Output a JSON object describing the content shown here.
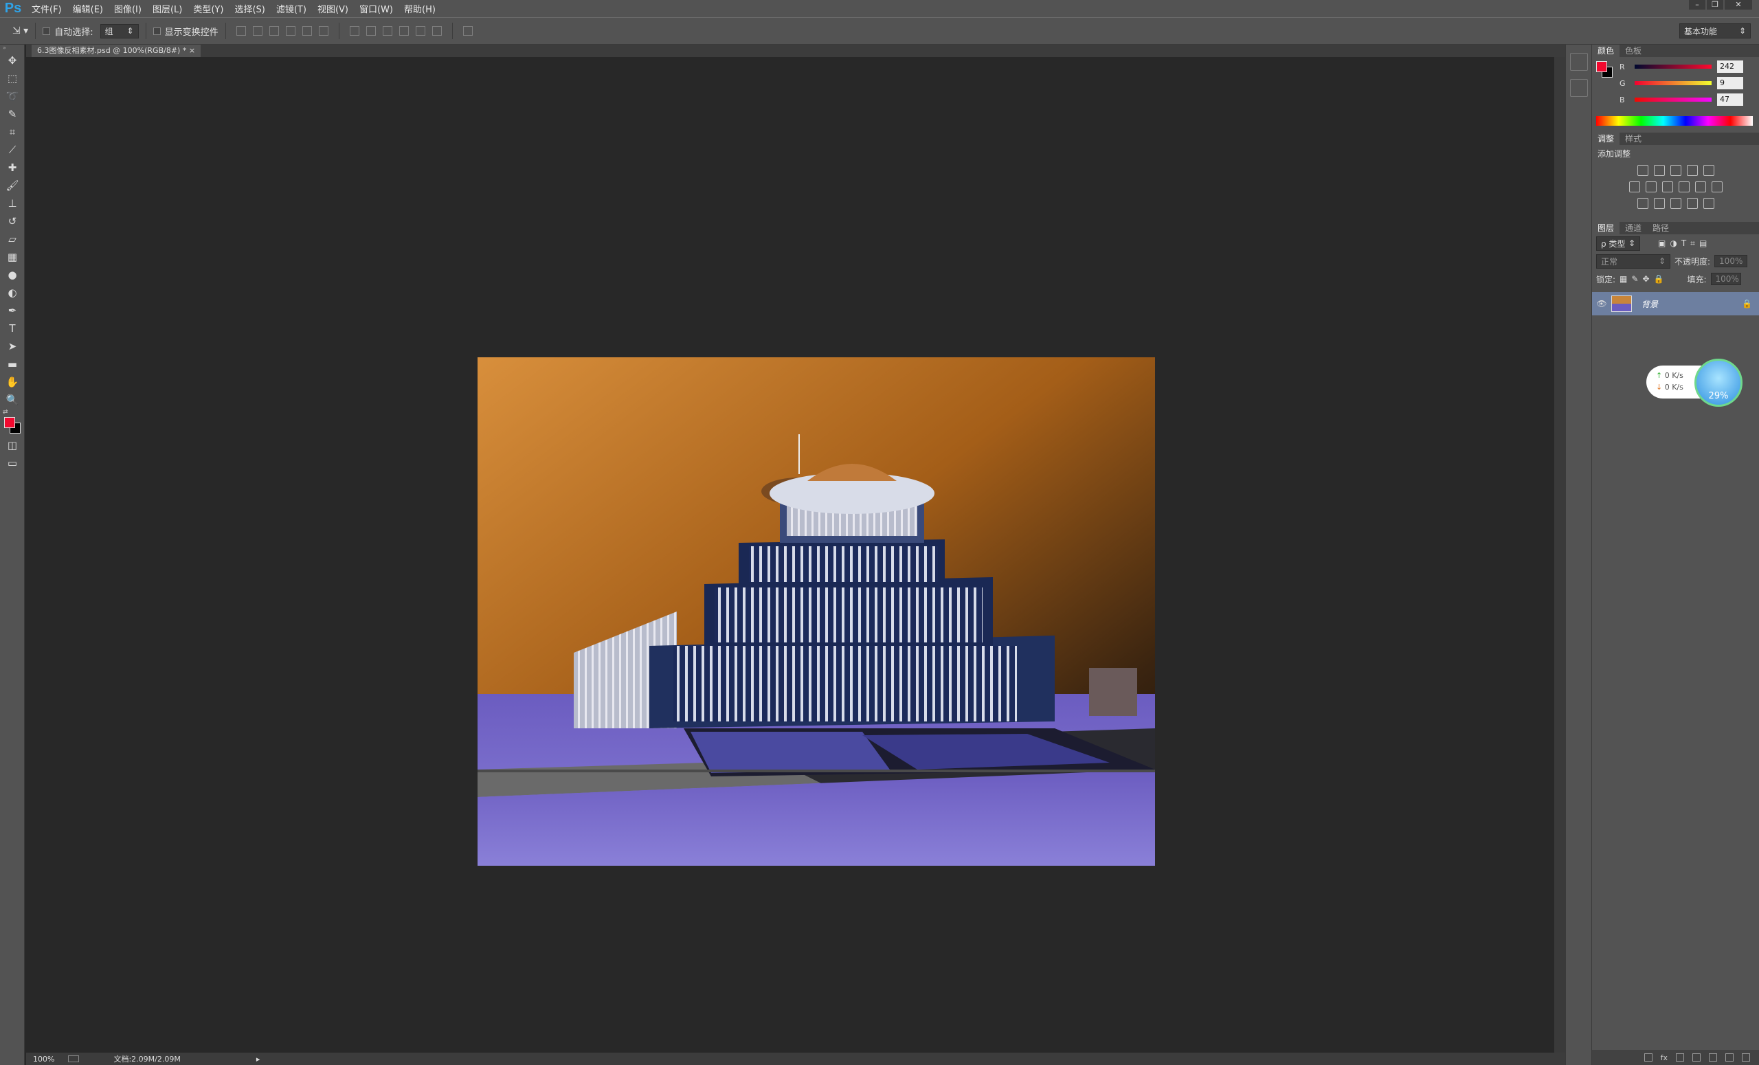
{
  "app": {
    "logo": "Ps"
  },
  "menu": [
    "文件(F)",
    "编辑(E)",
    "图像(I)",
    "图层(L)",
    "类型(Y)",
    "选择(S)",
    "滤镜(T)",
    "视图(V)",
    "窗口(W)",
    "帮助(H)"
  ],
  "options": {
    "auto_select_label": "自动选择:",
    "auto_select_value": "组",
    "show_transform_label": "显示变换控件",
    "workspace": "基本功能"
  },
  "document": {
    "tab_title": "6.3图像反相素材.psd @ 100%(RGB/8#) *",
    "close_glyph": "×"
  },
  "status": {
    "zoom": "100%",
    "doc_info": "文档:2.09M/2.09M"
  },
  "color_panel": {
    "tabs": [
      "颜色",
      "色板"
    ],
    "fg_color": "#f2092f",
    "channels": [
      {
        "name": "R",
        "value": "242"
      },
      {
        "name": "G",
        "value": "9"
      },
      {
        "name": "B",
        "value": "47"
      }
    ]
  },
  "adjust_panel": {
    "tabs": [
      "调整",
      "样式"
    ],
    "title": "添加调整"
  },
  "layers_panel": {
    "tabs": [
      "图层",
      "通道",
      "路径"
    ],
    "filter_label": "ρ 类型",
    "blend_mode": "正常",
    "opacity_label": "不透明度:",
    "opacity_value": "100%",
    "lock_label": "锁定:",
    "fill_label": "填充:",
    "fill_value": "100%",
    "layer_name": "背景"
  },
  "net_widget": {
    "up": "0  K/s",
    "down": "0  K/s",
    "percent": "29%"
  }
}
